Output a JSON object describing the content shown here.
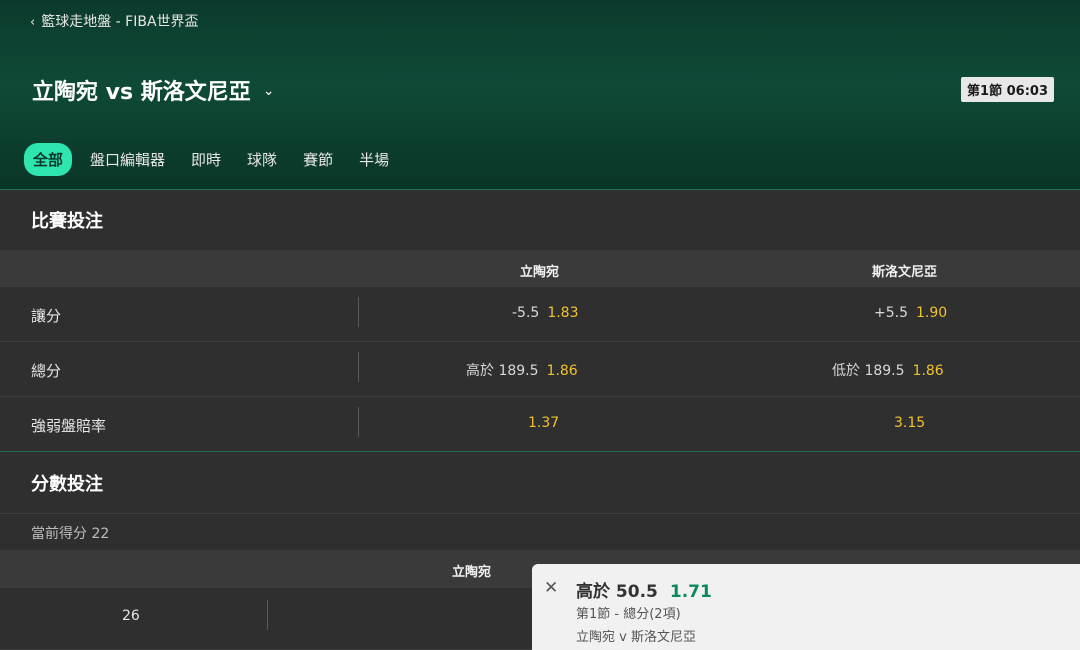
{
  "header": {
    "breadcrumb": "籃球走地盤 - FIBA世界盃",
    "match_title": "立陶宛 vs 斯洛文尼亞",
    "period_score": "第1節 06:03",
    "tabs": [
      "全部",
      "盤口編輯器",
      "即時",
      "球隊",
      "賽節",
      "半場"
    ],
    "active_tab": "全部"
  },
  "match_bets": {
    "title": "比賽投注",
    "columns": [
      "立陶宛",
      "斯洛文尼亞"
    ],
    "rows": [
      {
        "label": "讓分",
        "home_line": "-5.5",
        "home_odd": "1.83",
        "away_line": "+5.5",
        "away_odd": "1.90"
      },
      {
        "label": "總分",
        "home_line": "高於 189.5",
        "home_odd": "1.86",
        "away_line": "低於 189.5",
        "away_odd": "1.86"
      },
      {
        "label": "強弱盤賠率",
        "home_line": "",
        "home_odd": "1.37",
        "away_line": "",
        "away_odd": "3.15"
      }
    ]
  },
  "score_bets": {
    "title": "分數投注",
    "current_score": "當前得分 22",
    "columns": [
      "立陶宛"
    ],
    "rows": [
      {
        "label": "26"
      }
    ]
  },
  "betslip": {
    "selection": "高於 50.5",
    "odd": "1.71",
    "market": "第1節 - 總分(2項)",
    "event": "立陶宛 v 斯洛文尼亞"
  },
  "colors": {
    "accent": "#2fe6b0",
    "odd": "#f2c12e",
    "header_bg": "#0f4a37",
    "betslip_odd": "#0a8a5c"
  }
}
